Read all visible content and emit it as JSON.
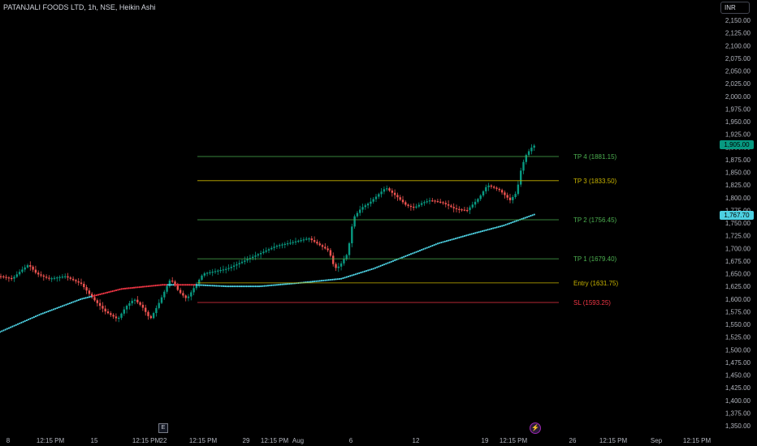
{
  "header": {
    "title": "PATANJALI FOODS LTD, 1h, NSE, Heikin Ashi",
    "currency": "INR"
  },
  "price_axis": {
    "ticks": [
      "2,150.00",
      "2,125.00",
      "2,100.00",
      "2,075.00",
      "2,050.00",
      "2,025.00",
      "2,000.00",
      "1,975.00",
      "1,950.00",
      "1,925.00",
      "1,900.00",
      "1,875.00",
      "1,850.00",
      "1,825.00",
      "1,800.00",
      "1,775.00",
      "1,750.00",
      "1,725.00",
      "1,700.00",
      "1,675.00",
      "1,650.00",
      "1,625.00",
      "1,600.00",
      "1,575.00",
      "1,550.00",
      "1,525.00",
      "1,500.00",
      "1,475.00",
      "1,450.00",
      "1,425.00",
      "1,400.00",
      "1,375.00",
      "1,350.00"
    ],
    "last_price": "1,905.00",
    "ma_price": "1,767.70"
  },
  "time_axis": {
    "ticks": [
      "8",
      "12:15 PM",
      "15",
      "12:15 PM",
      "22",
      "12:15 PM",
      "29",
      "12:15 PM",
      "Aug",
      "6",
      "12",
      "19",
      "12:15 PM",
      "26",
      "12:15 PM",
      "Sep",
      "12:15 PM"
    ]
  },
  "levels": [
    {
      "label": "TP 4 (1881.15)",
      "value": 1881.15,
      "color": "#4caf50"
    },
    {
      "label": "TP 3 (1833.50)",
      "value": 1833.5,
      "color": "#c8b400"
    },
    {
      "label": "TP 2 (1756.45)",
      "value": 1756.45,
      "color": "#4caf50"
    },
    {
      "label": "TP 1 (1679.40)",
      "value": 1679.4,
      "color": "#4caf50"
    },
    {
      "label": "Entry (1631.75)",
      "value": 1631.75,
      "color": "#c8b400"
    },
    {
      "label": "SL (1593.25)",
      "value": 1593.25,
      "color": "#f23645"
    }
  ],
  "markers": {
    "earnings": "E",
    "dividend": "⚡"
  },
  "colors": {
    "up": "#26a69a",
    "up_bright": "#089981",
    "down": "#ef5350",
    "ma_up": "#4dd0e1",
    "ma_down": "#f23645",
    "background": "#000000"
  },
  "chart_data": {
    "type": "candlestick",
    "title": "PATANJALI FOODS LTD, 1h, NSE, Heikin Ashi",
    "ylim": [
      1350,
      2150
    ],
    "price_path": [
      [
        0,
        1645
      ],
      [
        15,
        1640
      ],
      [
        25,
        1655
      ],
      [
        35,
        1668
      ],
      [
        45,
        1650
      ],
      [
        60,
        1640
      ],
      [
        80,
        1645
      ],
      [
        100,
        1630
      ],
      [
        115,
        1600
      ],
      [
        130,
        1575
      ],
      [
        145,
        1560
      ],
      [
        155,
        1585
      ],
      [
        165,
        1600
      ],
      [
        175,
        1585
      ],
      [
        185,
        1560
      ],
      [
        195,
        1590
      ],
      [
        210,
        1640
      ],
      [
        220,
        1615
      ],
      [
        230,
        1600
      ],
      [
        240,
        1625
      ],
      [
        250,
        1650
      ],
      [
        265,
        1655
      ],
      [
        280,
        1660
      ],
      [
        300,
        1675
      ],
      [
        320,
        1690
      ],
      [
        340,
        1705
      ],
      [
        360,
        1712
      ],
      [
        380,
        1720
      ],
      [
        395,
        1705
      ],
      [
        405,
        1695
      ],
      [
        412,
        1660
      ],
      [
        418,
        1665
      ],
      [
        428,
        1690
      ],
      [
        435,
        1760
      ],
      [
        445,
        1780
      ],
      [
        455,
        1790
      ],
      [
        465,
        1805
      ],
      [
        475,
        1820
      ],
      [
        490,
        1800
      ],
      [
        500,
        1785
      ],
      [
        510,
        1780
      ],
      [
        520,
        1790
      ],
      [
        530,
        1795
      ],
      [
        545,
        1790
      ],
      [
        560,
        1778
      ],
      [
        575,
        1775
      ],
      [
        590,
        1800
      ],
      [
        600,
        1825
      ],
      [
        615,
        1815
      ],
      [
        628,
        1795
      ],
      [
        636,
        1810
      ],
      [
        642,
        1860
      ],
      [
        648,
        1885
      ],
      [
        655,
        1900
      ],
      [
        660,
        1905
      ]
    ],
    "moving_average": [
      [
        0,
        1535
      ],
      [
        50,
        1570
      ],
      [
        100,
        1600
      ],
      [
        150,
        1620
      ],
      [
        200,
        1628
      ],
      [
        240,
        1628
      ],
      [
        280,
        1625
      ],
      [
        320,
        1625
      ],
      [
        370,
        1632
      ],
      [
        420,
        1640
      ],
      [
        460,
        1660
      ],
      [
        500,
        1685
      ],
      [
        540,
        1710
      ],
      [
        580,
        1728
      ],
      [
        620,
        1745
      ],
      [
        660,
        1768
      ]
    ]
  }
}
